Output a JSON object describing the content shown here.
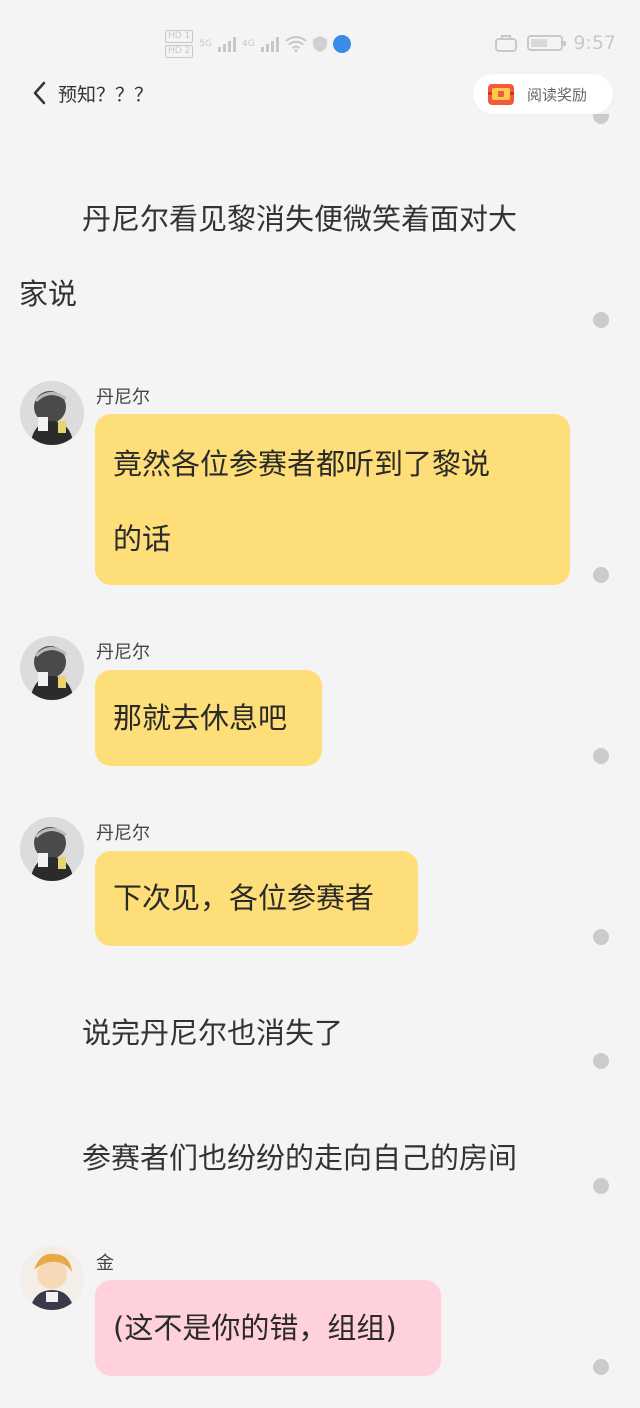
{
  "status_bar": {
    "sim1": "HD 1",
    "sim2": "HD 2",
    "net1": "5G",
    "net2": "4G",
    "time": "9:57"
  },
  "header": {
    "back_title": "预知？？？",
    "reward_label": "阅读奖励"
  },
  "story": {
    "narration_1_line1": "丹尼尔看见黎消失便微笑着面对大",
    "narration_1_line2": "家说",
    "messages": [
      {
        "speaker": "丹尼尔",
        "line1": "竟然各位参赛者都听到了黎说",
        "line2": "的话"
      },
      {
        "speaker": "丹尼尔",
        "text": "那就去休息吧"
      },
      {
        "speaker": "丹尼尔",
        "text": "下次见，各位参赛者"
      }
    ],
    "narration_2": "说完丹尼尔也消失了",
    "narration_3": "参赛者们也纷纷的走向自己的房间",
    "last_message": {
      "speaker": "金",
      "text": "(这不是你的错，组组)"
    }
  },
  "colors": {
    "background": "#f4f4f4",
    "bubble_daniel": "#fede78",
    "bubble_jin": "#ffd1dc",
    "dot": "#cbcbcb"
  },
  "icons": {
    "back": "chevron-left-icon",
    "reward": "treasure-chest-icon",
    "more": "dot-icon"
  }
}
